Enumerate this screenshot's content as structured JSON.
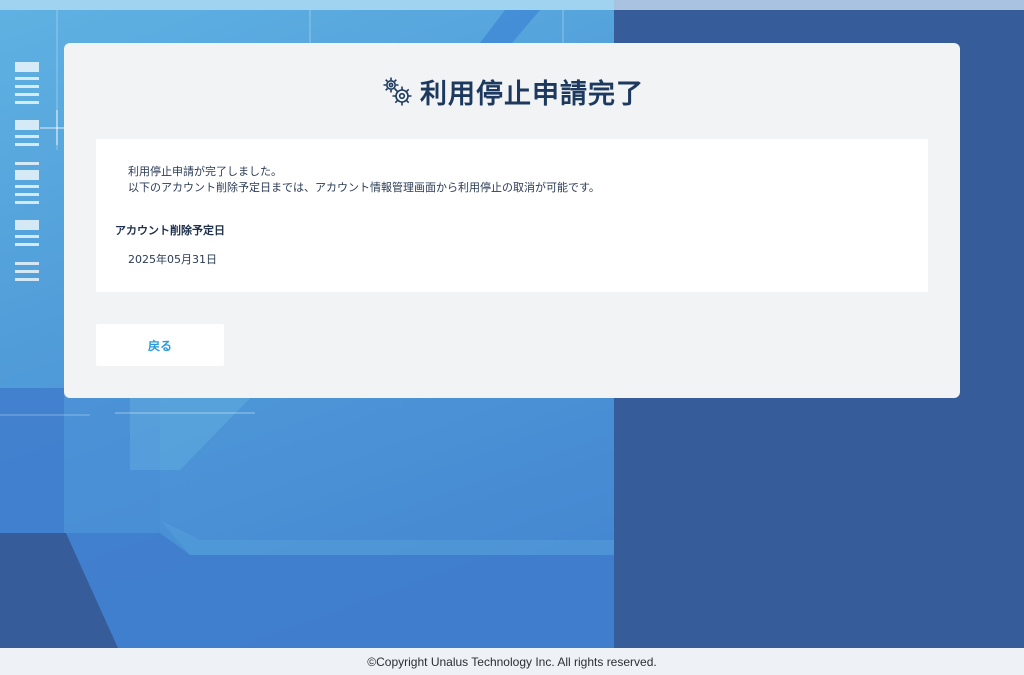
{
  "page": {
    "title": "利用停止申請完了",
    "title_icon": "gears-icon"
  },
  "message": {
    "line1": "利用停止申請が完了しました。",
    "line2": "以下のアカウント削除予定日までは、アカウント情報管理画面から利用停止の取消が可能です。"
  },
  "deletion": {
    "label": "アカウント削除予定日",
    "value": "2025年05月31日"
  },
  "buttons": {
    "back_label": "戻る"
  },
  "footer": {
    "copyright": "©Copyright Unalus Technology Inc. All rights reserved."
  },
  "colors": {
    "title": "#1d3a5e",
    "link": "#2a9bd9",
    "bg_right": "#365d99",
    "bg_left": "#4f9ad8",
    "card": "#f2f3f5"
  }
}
